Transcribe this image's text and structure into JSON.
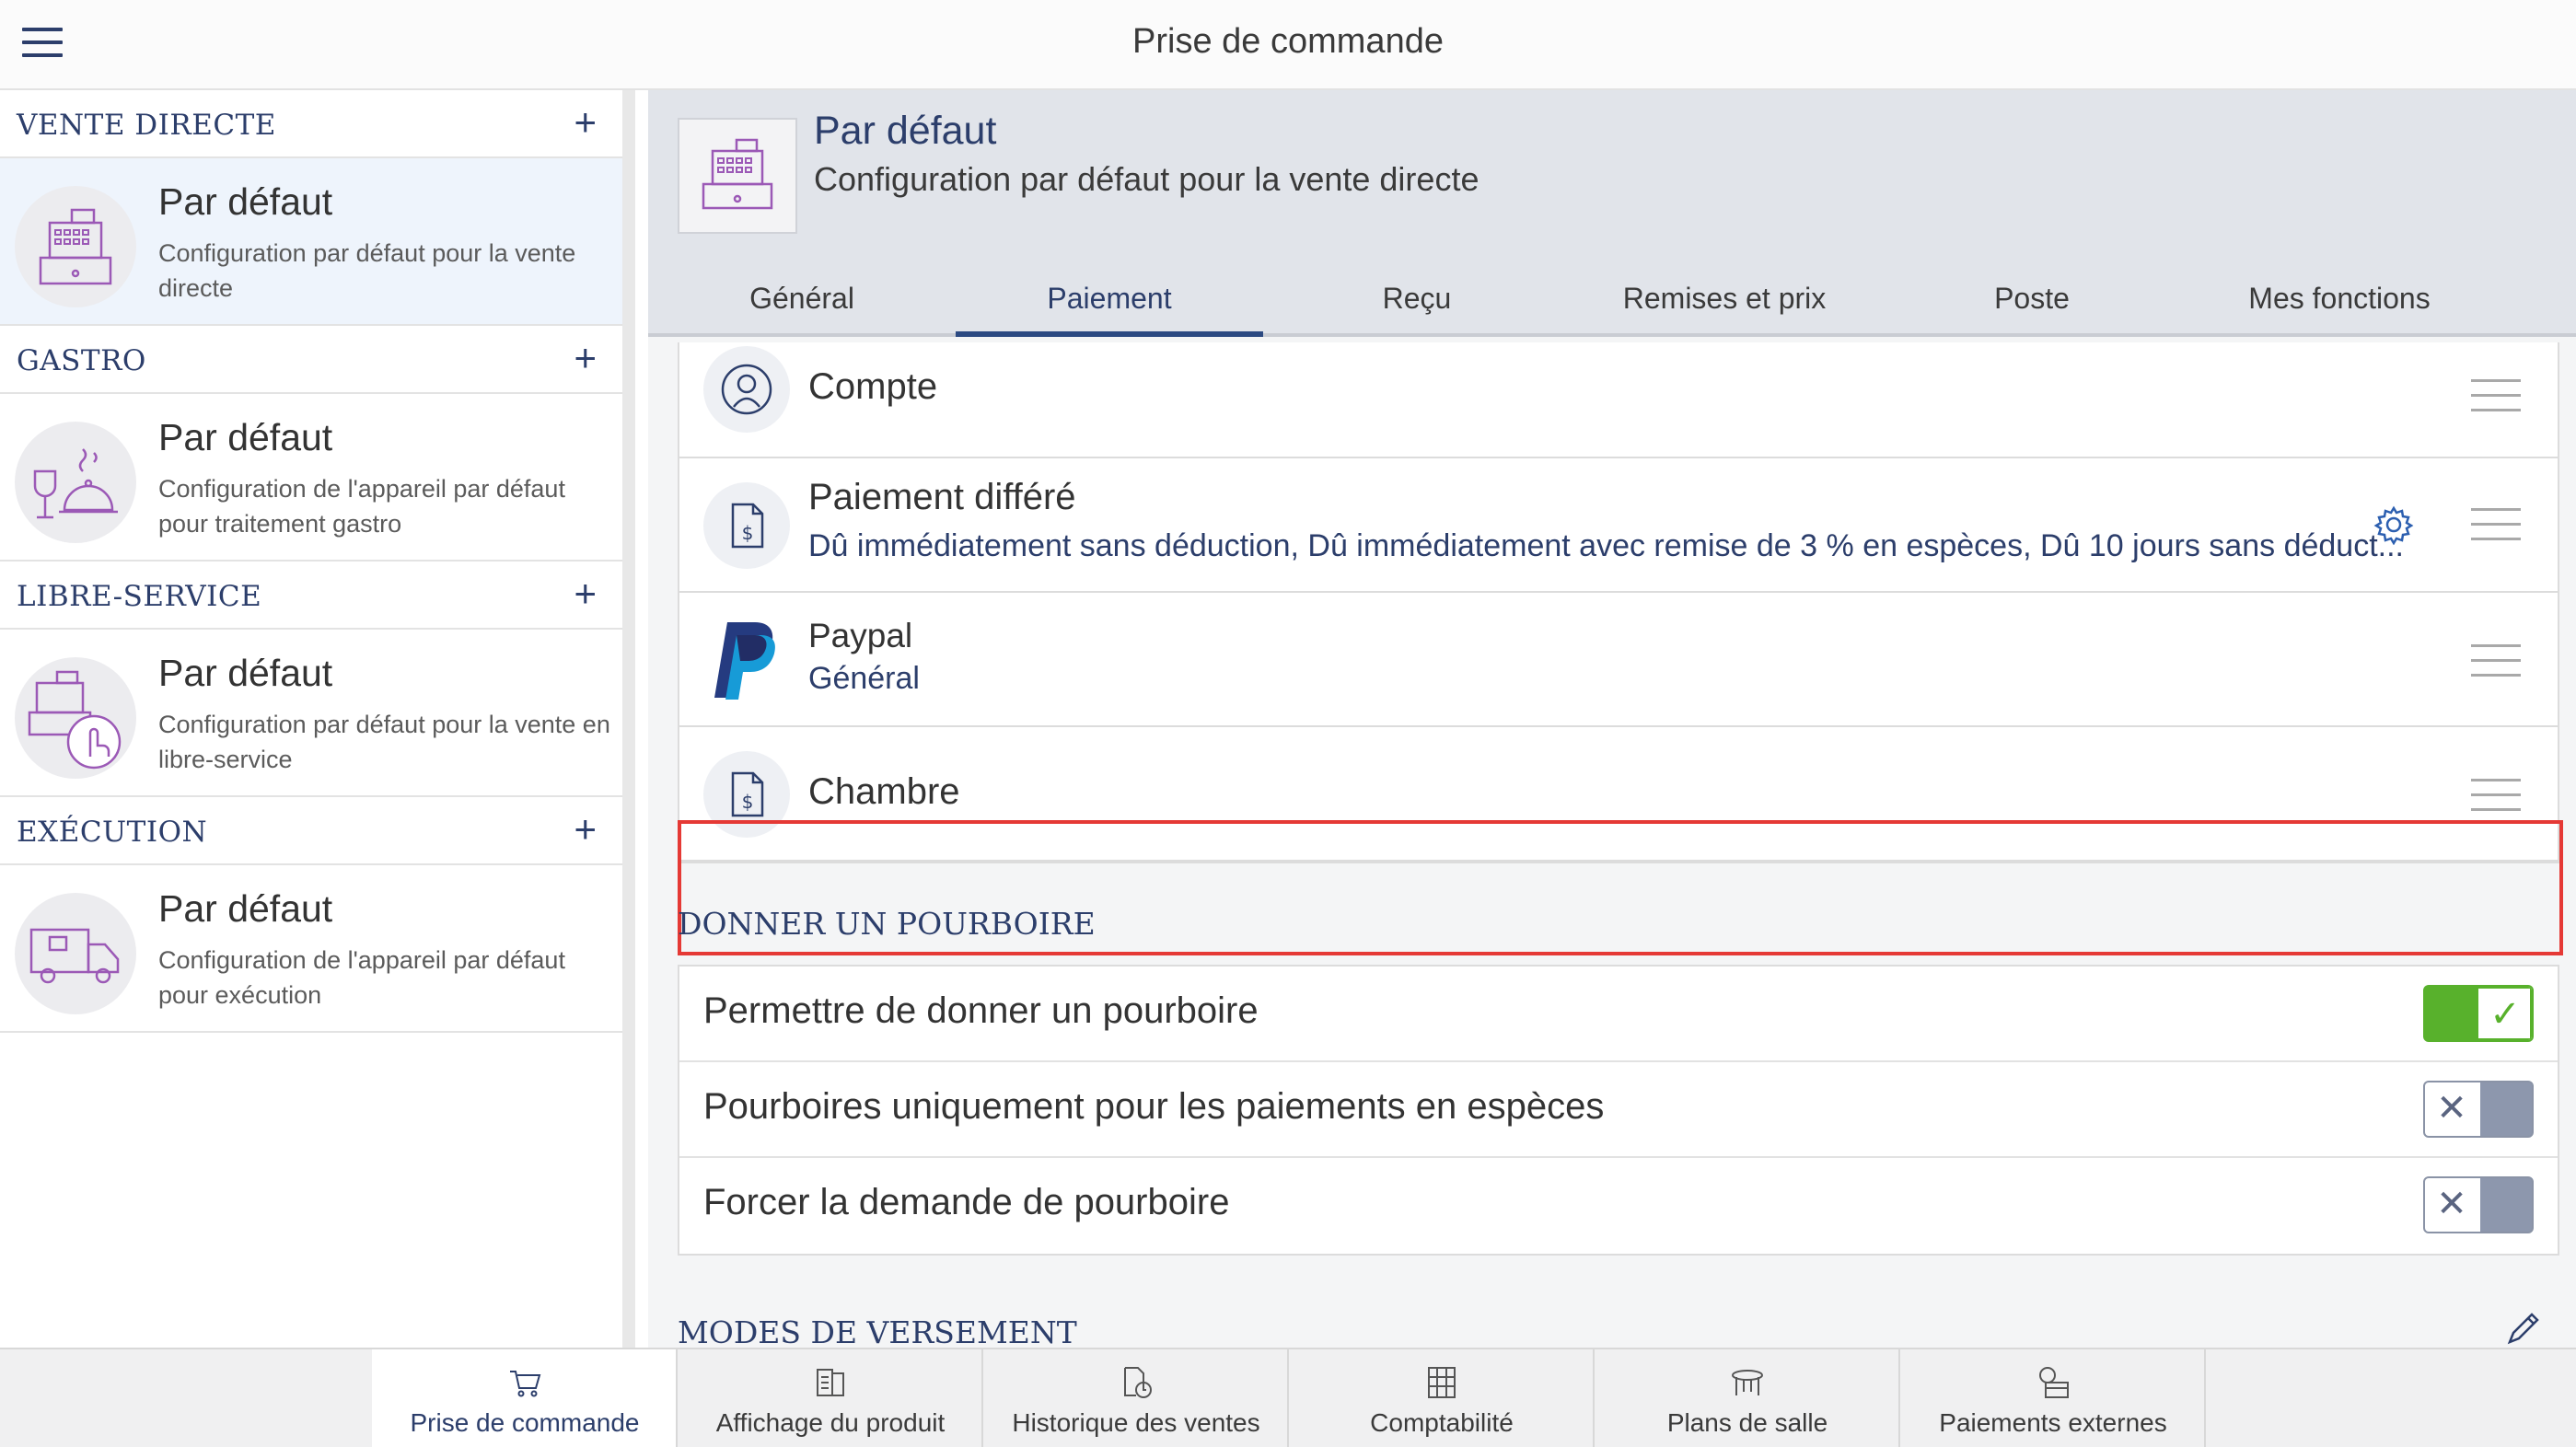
{
  "app": {
    "title": "Prise de commande"
  },
  "sidebar": {
    "sections": [
      {
        "title": "VENTE DIRECTE",
        "item": {
          "title": "Par défaut",
          "desc": "Configuration par défaut pour la vente directe",
          "icon": "cash-register-icon"
        }
      },
      {
        "title": "GASTRO",
        "item": {
          "title": "Par défaut",
          "desc": "Configuration de l'appareil par défaut pour traitement gastro",
          "icon": "wine-glass-cloche-icon"
        }
      },
      {
        "title": "LIBRE-SERVICE",
        "item": {
          "title": "Par défaut",
          "desc": "Configuration par défaut pour la vente en libre-service",
          "icon": "self-service-register-icon"
        }
      },
      {
        "title": "EXÉCUTION",
        "item": {
          "title": "Par défaut",
          "desc": "Configuration de l'appareil par défaut pour exécution",
          "icon": "delivery-truck-icon"
        }
      }
    ],
    "add_symbol": "+"
  },
  "detail": {
    "title": "Par défaut",
    "subtitle": "Configuration par défaut pour la vente directe",
    "tabs": [
      "Général",
      "Paiement",
      "Reçu",
      "Remises et prix",
      "Poste",
      "Mes fonctions"
    ],
    "active_tab": "Paiement"
  },
  "payments": [
    {
      "title": "Compte",
      "subtitle": "",
      "icon": "user-account-icon"
    },
    {
      "title": "Paiement différé",
      "subtitle": "Dû immédiatement sans déduction, Dû immédiatement avec remise de 3 % en espèces, Dû 10 jours sans déduct...",
      "icon": "invoice-dollar-icon"
    },
    {
      "title": "Paypal",
      "subtitle": "Général",
      "icon": "paypal-logo-icon"
    },
    {
      "title": "Chambre",
      "subtitle": "",
      "icon": "invoice-dollar-icon"
    }
  ],
  "tips": {
    "title": "DONNER UN POURBOIRE",
    "rows": [
      {
        "label": "Permettre de donner un pourboire",
        "on": true
      },
      {
        "label": "Pourboires uniquement pour les paiements en espèces",
        "on": false
      },
      {
        "label": "Forcer la demande de pourboire",
        "on": false
      }
    ]
  },
  "modes": {
    "title": "MODES DE VERSEMENT"
  },
  "bottom_nav": [
    {
      "label": "Prise de commande",
      "icon": "cart-icon",
      "active": true
    },
    {
      "label": "Affichage du produit",
      "icon": "product-display-icon",
      "active": false
    },
    {
      "label": "Historique des ventes",
      "icon": "sales-history-icon",
      "active": false
    },
    {
      "label": "Comptabilité",
      "icon": "accounting-icon",
      "active": false
    },
    {
      "label": "Plans de salle",
      "icon": "table-icon",
      "active": false
    },
    {
      "label": "Paiements externes",
      "icon": "external-payment-icon",
      "active": false
    }
  ],
  "colors": {
    "accent": "#2c3e6b",
    "toggle_on": "#58b12c",
    "toggle_off": "#8d97ad",
    "highlight": "#e53935",
    "icon_purple": "#9b59b6"
  }
}
